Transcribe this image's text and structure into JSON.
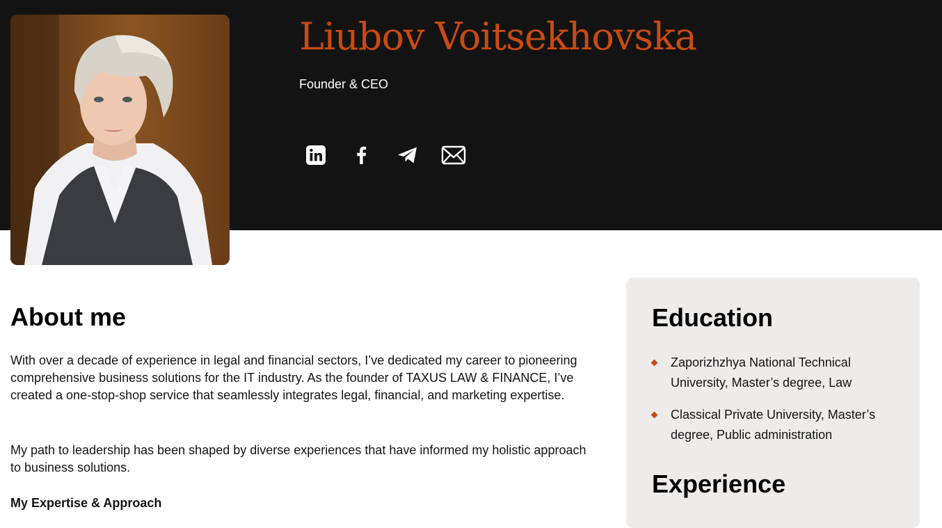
{
  "colors": {
    "accent": "#c84b12",
    "header_bg": "#141313",
    "card_bg": "#eeeceb",
    "text": "#141414",
    "icon": "#ffffff"
  },
  "profile": {
    "name": "Liubov Voitsekhovska",
    "title": "Founder & CEO",
    "photo_icon": "portrait-photo"
  },
  "socials": [
    {
      "icon": "linkedin-icon"
    },
    {
      "icon": "facebook-icon"
    },
    {
      "icon": "telegram-icon"
    },
    {
      "icon": "email-icon"
    }
  ],
  "about": {
    "heading": "About me",
    "paragraphs": [
      "With over a decade of experience in legal and financial sectors, I’ve dedicated my career to pioneering comprehensive business solutions for the IT industry. As the founder of TAXUS LAW & FINANCE, I’ve created a one-stop-shop service that seamlessly integrates legal, financial, and marketing expertise.",
      "My path to leadership has been shaped by diverse experiences that have informed my holistic approach to business solutions."
    ],
    "subheading": "My Expertise & Approach"
  },
  "education": {
    "heading": "Education",
    "items": [
      "Zaporizhzhya National Technical University, Master’s degree, Law",
      "Classical Private University, Master’s degree, Public administration"
    ]
  },
  "experience": {
    "heading": "Experience"
  }
}
